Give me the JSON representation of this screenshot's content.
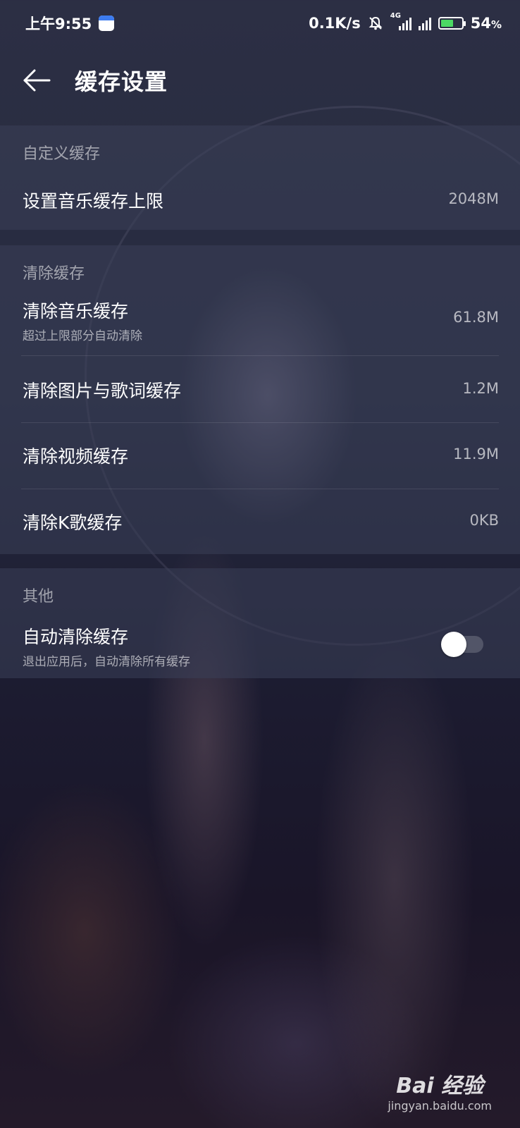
{
  "status_bar": {
    "time": "上午9:55",
    "network_speed": "0.1K/s",
    "battery_percent": "54",
    "battery_suffix": "%",
    "network_type": "4G",
    "icons": [
      "calendar-icon",
      "mute-bell-icon",
      "signal-4g-icon",
      "signal-icon",
      "battery-charging-icon"
    ]
  },
  "header": {
    "title": "缓存设置",
    "back_icon": "arrow-left-icon"
  },
  "sections": {
    "custom": {
      "label": "自定义缓存",
      "items": [
        {
          "title": "设置音乐缓存上限",
          "value": "2048M"
        }
      ]
    },
    "clear": {
      "label": "清除缓存",
      "items": [
        {
          "title": "清除音乐缓存",
          "subtitle": "超过上限部分自动清除",
          "value": "61.8M"
        },
        {
          "title": "清除图片与歌词缓存",
          "value": "1.2M"
        },
        {
          "title": "清除视频缓存",
          "value": "11.9M"
        },
        {
          "title": "清除K歌缓存",
          "value": "0KB"
        }
      ]
    },
    "other": {
      "label": "其他",
      "items": [
        {
          "title": "自动清除缓存",
          "subtitle": "退出应用后，自动清除所有缓存",
          "toggle_on": false
        }
      ]
    }
  },
  "watermark": {
    "brand": "Bai 经验",
    "url": "jingyan.baidu.com"
  },
  "colors": {
    "accent": "#ffffff",
    "section_bg": "#3a4058",
    "battery_fill": "#4cd964"
  }
}
